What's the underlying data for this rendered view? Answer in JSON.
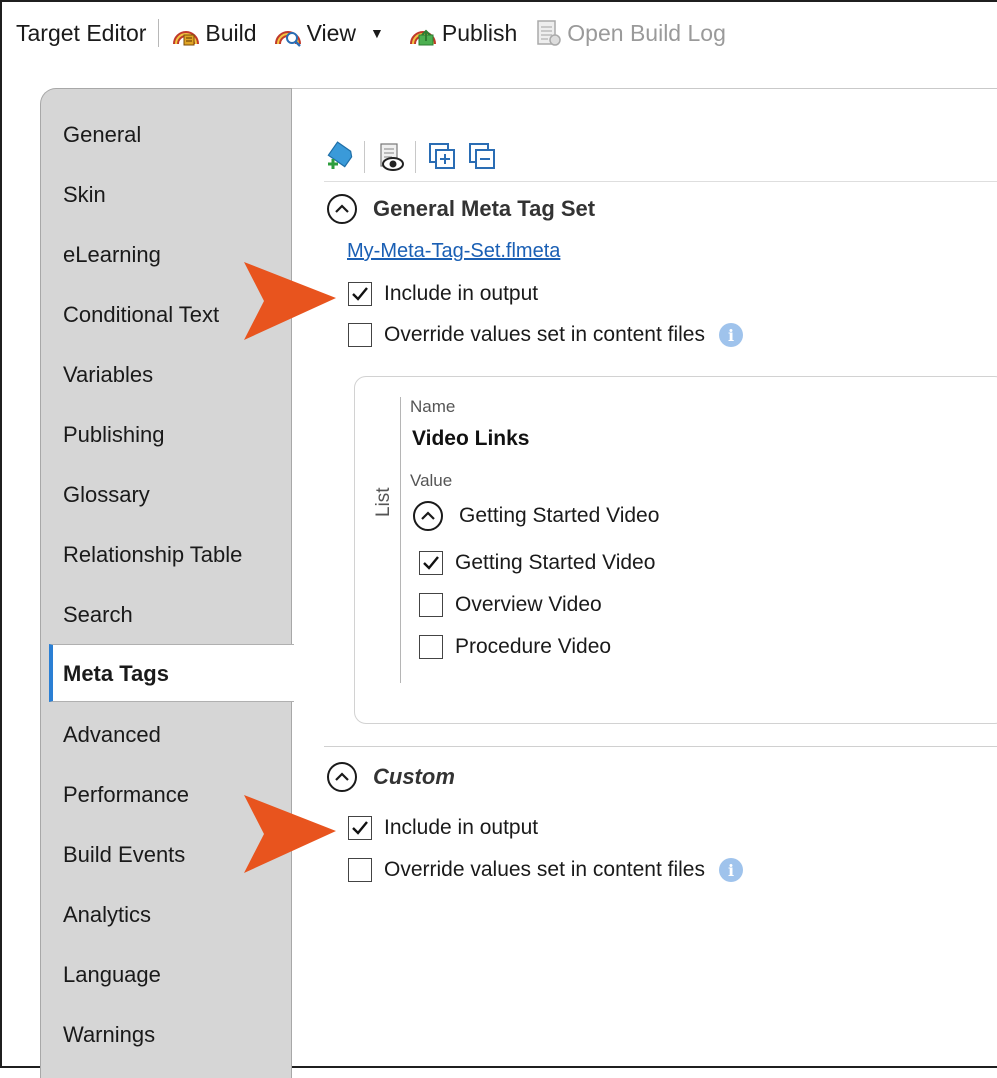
{
  "toolbar": {
    "title": "Target Editor",
    "build": "Build",
    "view": "View",
    "publish": "Publish",
    "open_build_log": "Open Build Log"
  },
  "nav": {
    "items": [
      "General",
      "Skin",
      "eLearning",
      "Conditional Text",
      "Variables",
      "Publishing",
      "Glossary",
      "Relationship Table",
      "Search",
      "Meta Tags",
      "Advanced",
      "Performance",
      "Build Events",
      "Analytics",
      "Language",
      "Warnings"
    ],
    "active": "Meta Tags"
  },
  "general_section": {
    "title": "General Meta Tag Set",
    "file_link": "My-Meta-Tag-Set.flmeta",
    "include_label": "Include in output",
    "include_checked": true,
    "override_label": "Override values set in content files",
    "override_checked": false
  },
  "meta_card": {
    "side_label": "List",
    "name_label": "Name",
    "name_value": "Video Links",
    "value_label": "Value",
    "group_title": "Getting Started Video",
    "options": [
      {
        "label": "Getting Started Video",
        "checked": true
      },
      {
        "label": "Overview Video",
        "checked": false
      },
      {
        "label": "Procedure Video",
        "checked": false
      }
    ]
  },
  "custom_section": {
    "title": "Custom",
    "include_label": "Include in output",
    "include_checked": true,
    "override_label": "Override values set in content files",
    "override_checked": false
  },
  "colors": {
    "callout_arrow": "#e8541e",
    "active_nav_accent": "#2a7fd4",
    "link": "#1a5fb4",
    "nav_background": "#d6d6d6"
  }
}
